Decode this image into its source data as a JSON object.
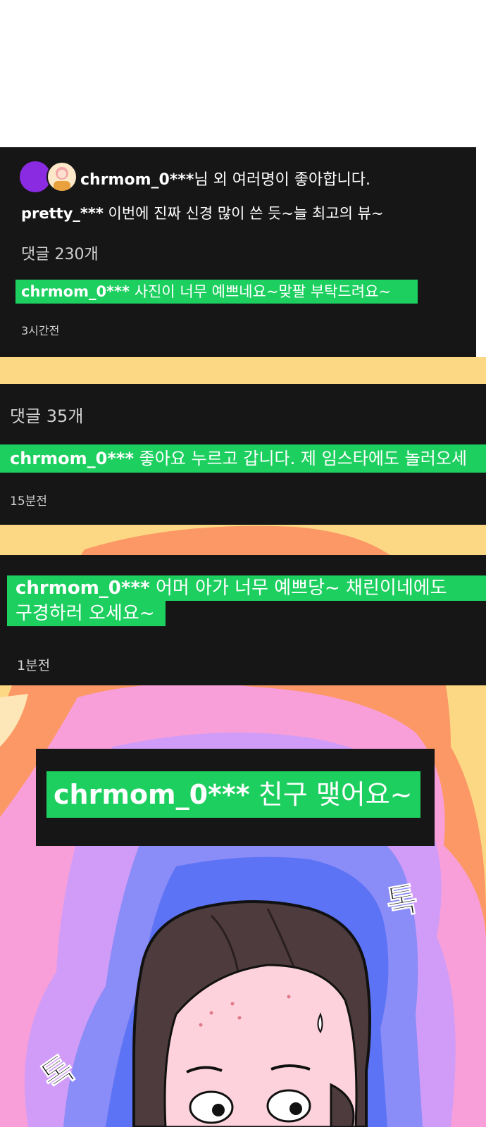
{
  "panel1": {
    "likes_user": "chrmom_0***",
    "likes_suffix": "님 외 여러명이 좋아합니다.",
    "caption_user": "pretty_***",
    "caption_text": "이번에 진짜 신경 많이 쓴 듯~늘 최고의 뷰~",
    "comment_count": "댓글 230개",
    "comment_user": "chrmom_0***",
    "comment_text": "사진이 너무 예쁘네요~맞팔 부탁드려요~",
    "time": "3시간전"
  },
  "panel2": {
    "comment_count": "댓글 35개",
    "comment_user": "chrmom_0***",
    "comment_text": "좋아요 누르고 갑니다. 제 임스타에도 놀러오세",
    "time": "15분전"
  },
  "panel3": {
    "comment_user": "chrmom_0***",
    "comment_text_line1": "어머 아가 너무 예쁘당~ 채린이네에도",
    "comment_text_line2": "구경하러 오세요~",
    "time": "1분전"
  },
  "panel4": {
    "comment_user": "chrmom_0***",
    "comment_text": "친구 맺어요~"
  },
  "sfx": {
    "right": "톡",
    "left": "톡"
  },
  "colors": {
    "panel_bg": "#161616",
    "highlight": "#1dcf5f",
    "avatar_purple": "#8a2be2",
    "strip_yellow": "#fdd884"
  }
}
